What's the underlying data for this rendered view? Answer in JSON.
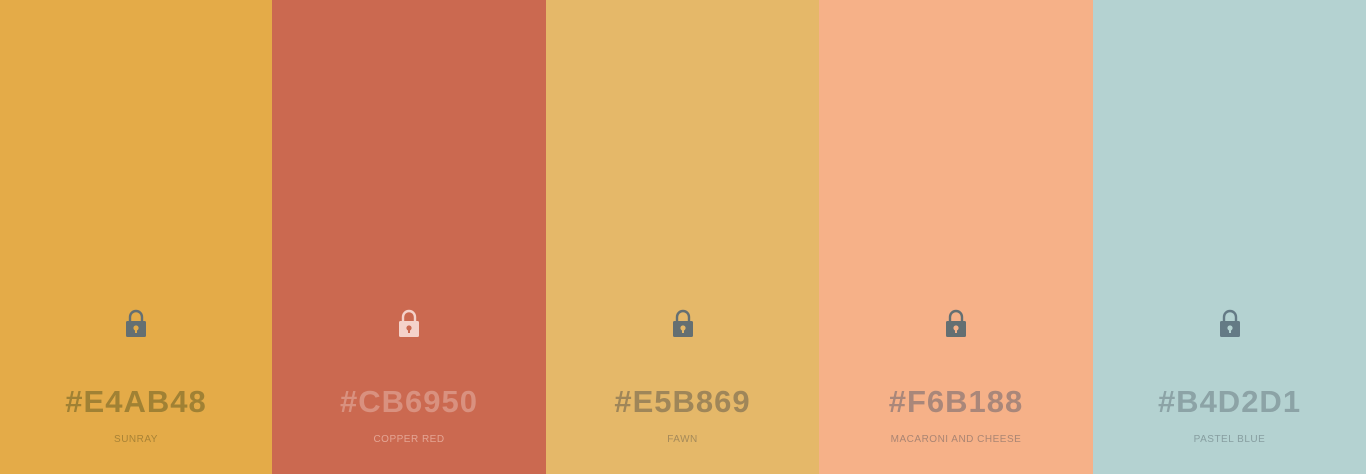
{
  "colors": [
    {
      "hex": "#E4AB48",
      "name": "SUNRAY",
      "bg": "#E4AB48",
      "text_color": "#A08134",
      "name_color": "#A98336",
      "lock_color": "#646F72",
      "lock_icon": "lock-icon"
    },
    {
      "hex": "#CB6950",
      "name": "COPPER RED",
      "bg": "#CB6950",
      "text_color": "#D9917F",
      "name_color": "#E4A594",
      "lock_color": "#F4D2CA",
      "lock_icon": "lock-icon"
    },
    {
      "hex": "#E5B869",
      "name": "FAWN",
      "bg": "#E5B869",
      "text_color": "#9F8659",
      "name_color": "#A58A5A",
      "lock_color": "#646F72",
      "lock_icon": "lock-icon"
    },
    {
      "hex": "#F6B188",
      "name": "MACARONI AND CHEESE",
      "bg": "#F6B188",
      "text_color": "#A9877A",
      "name_color": "#AA8573",
      "lock_color": "#646F72",
      "lock_icon": "lock-icon"
    },
    {
      "hex": "#B4D2D1",
      "name": "PASTEL BLUE",
      "bg": "#B4D2D1",
      "text_color": "#8CA3A6",
      "name_color": "#879EA0",
      "lock_color": "#647A85",
      "lock_icon": "lock-icon"
    }
  ]
}
